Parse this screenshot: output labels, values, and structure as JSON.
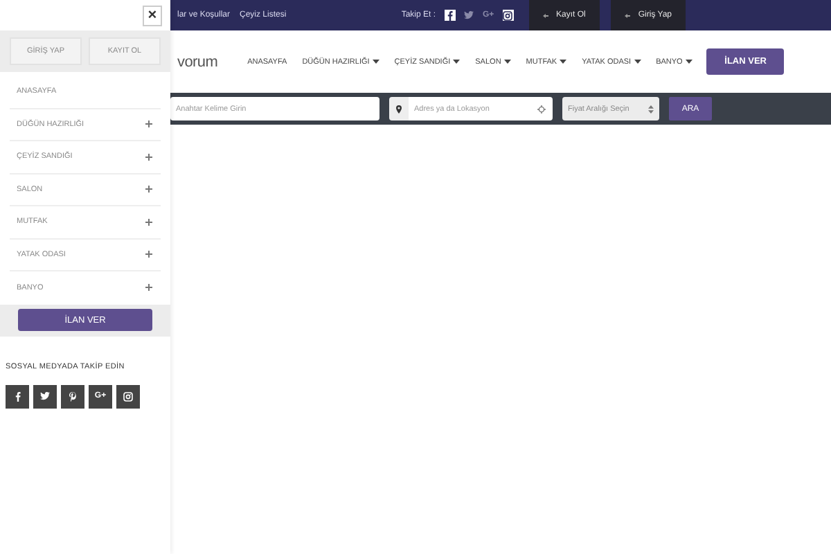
{
  "panel": {
    "close_label": "×",
    "auth_buttons": [
      "GİRİŞ YAP",
      "KAYIT OL"
    ],
    "menu": [
      {
        "label": "ANASAYFA",
        "expandable": false
      },
      {
        "label": "DÜĞÜN HAZIRLIĞI",
        "expandable": true
      },
      {
        "label": "ÇEYİZ SANDIĞI",
        "expandable": true
      },
      {
        "label": "SALON",
        "expandable": true
      },
      {
        "label": "MUTFAK",
        "expandable": true
      },
      {
        "label": "YATAK ODASI",
        "expandable": true
      },
      {
        "label": "BANYO",
        "expandable": true
      }
    ],
    "cta": "İLAN VER",
    "social_title": "SOSYAL MEDYADA TAKİP EDİN",
    "social": [
      {
        "kind": "facebook"
      },
      {
        "kind": "twitter"
      },
      {
        "kind": "pinterest"
      },
      {
        "kind": "googleplus",
        "label": "G+"
      },
      {
        "kind": "instagram"
      }
    ]
  },
  "top_bar": {
    "links": [
      "lar ve Koşullar",
      "Çeyiz Listesi"
    ],
    "follow_label": "Takip Et :",
    "social": [
      {
        "kind": "facebook",
        "boxed": true
      },
      {
        "kind": "twitter",
        "boxed": false
      },
      {
        "kind": "googleplus",
        "label": "G+",
        "boxed": false
      },
      {
        "kind": "instagram",
        "boxed": true
      }
    ],
    "buttons": [
      "Kayıt Ol",
      "Giriş Yap"
    ]
  },
  "header": {
    "logo": "vorum",
    "nav": [
      {
        "label": "ANASAYFA",
        "dropdown": false
      },
      {
        "label": "DÜĞÜN HAZIRLIĞI",
        "dropdown": true
      },
      {
        "label": "ÇEYİZ SANDIĞI",
        "dropdown": true
      },
      {
        "label": "SALON",
        "dropdown": true
      },
      {
        "label": "MUTFAK",
        "dropdown": true
      },
      {
        "label": "YATAK ODASI",
        "dropdown": true
      },
      {
        "label": "BANYO",
        "dropdown": true
      }
    ],
    "cta": "İLAN VER"
  },
  "search": {
    "keyword_placeholder": "Anahtar Kelime Girin",
    "location_placeholder": "Adres ya da Lokasyon",
    "price_placeholder": "Fiyat Aralığı Seçin",
    "button": "ARA"
  }
}
